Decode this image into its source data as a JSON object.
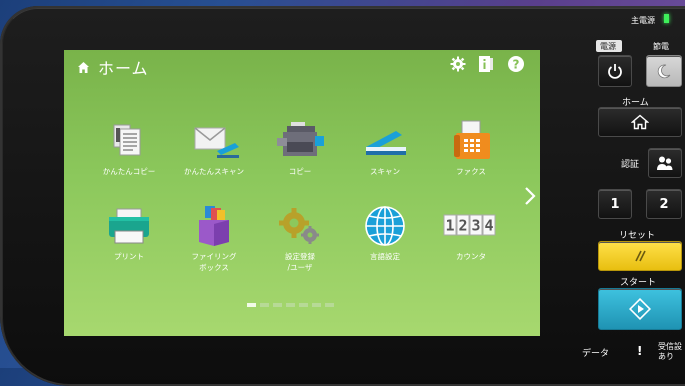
{
  "panel": {
    "main_power_label": "主電源",
    "power_label": "電源",
    "eco_label": "節電",
    "home_label": "ホーム",
    "auth_label": "認証",
    "key1_label": "1",
    "key2_label": "2",
    "reset_label": "リセット",
    "start_label": "スタート",
    "data_label": "データ",
    "error_label": "!",
    "receive_label": "受信設\nあり"
  },
  "screen": {
    "title": "ホーム",
    "page_count": 7,
    "active_page": 1,
    "apps": [
      {
        "label": "かんたんコピー",
        "icon": "easy-copy-icon"
      },
      {
        "label": "かんたんスキャン",
        "icon": "easy-scan-icon"
      },
      {
        "label": "コピー",
        "icon": "copy-icon"
      },
      {
        "label": "スキャン",
        "icon": "scan-icon"
      },
      {
        "label": "ファクス",
        "icon": "fax-icon"
      },
      {
        "label": "プリント",
        "icon": "print-icon"
      },
      {
        "label": "ファイリング\nボックス",
        "icon": "filing-box-icon"
      },
      {
        "label": "設定登録\n/ユーザ",
        "icon": "settings-user-icon"
      },
      {
        "label": "言語設定",
        "icon": "language-icon"
      },
      {
        "label": "カウンタ",
        "icon": "counter-icon"
      }
    ]
  },
  "colors": {
    "screen_green": "#8cc85c",
    "reset_yellow": "#f4cf28",
    "start_teal": "#2aa9c6",
    "led_green": "#3ef05a"
  }
}
